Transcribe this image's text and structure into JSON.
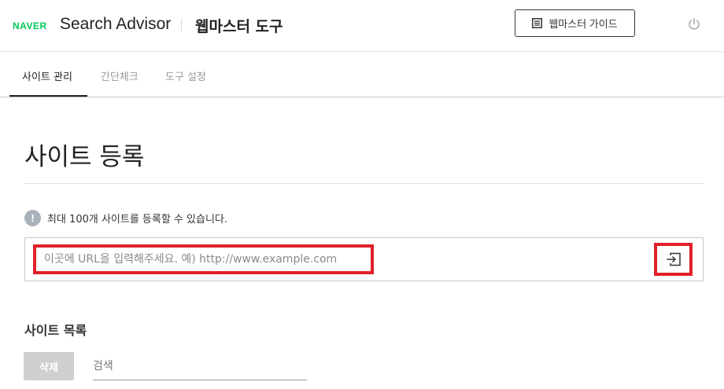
{
  "header": {
    "logo": "NAVER",
    "app_name": "Search Advisor",
    "tool_title": "웹마스터 도구",
    "guide_button": "웹마스터 가이드"
  },
  "tabs": [
    {
      "label": "사이트 관리",
      "active": true
    },
    {
      "label": "간단체크",
      "active": false
    },
    {
      "label": "도구 설정",
      "active": false
    }
  ],
  "main": {
    "title": "사이트 등록",
    "notice": "최대 100개 사이트를 등록할 수 있습니다.",
    "url_placeholder": "이곳에 URL을 입력해주세요. 예) http://www.example.com",
    "list_title": "사이트 목록",
    "delete_button": "삭제",
    "search_placeholder": "검색"
  },
  "colors": {
    "brand": "#03c75a",
    "highlight": "#e0202a"
  }
}
